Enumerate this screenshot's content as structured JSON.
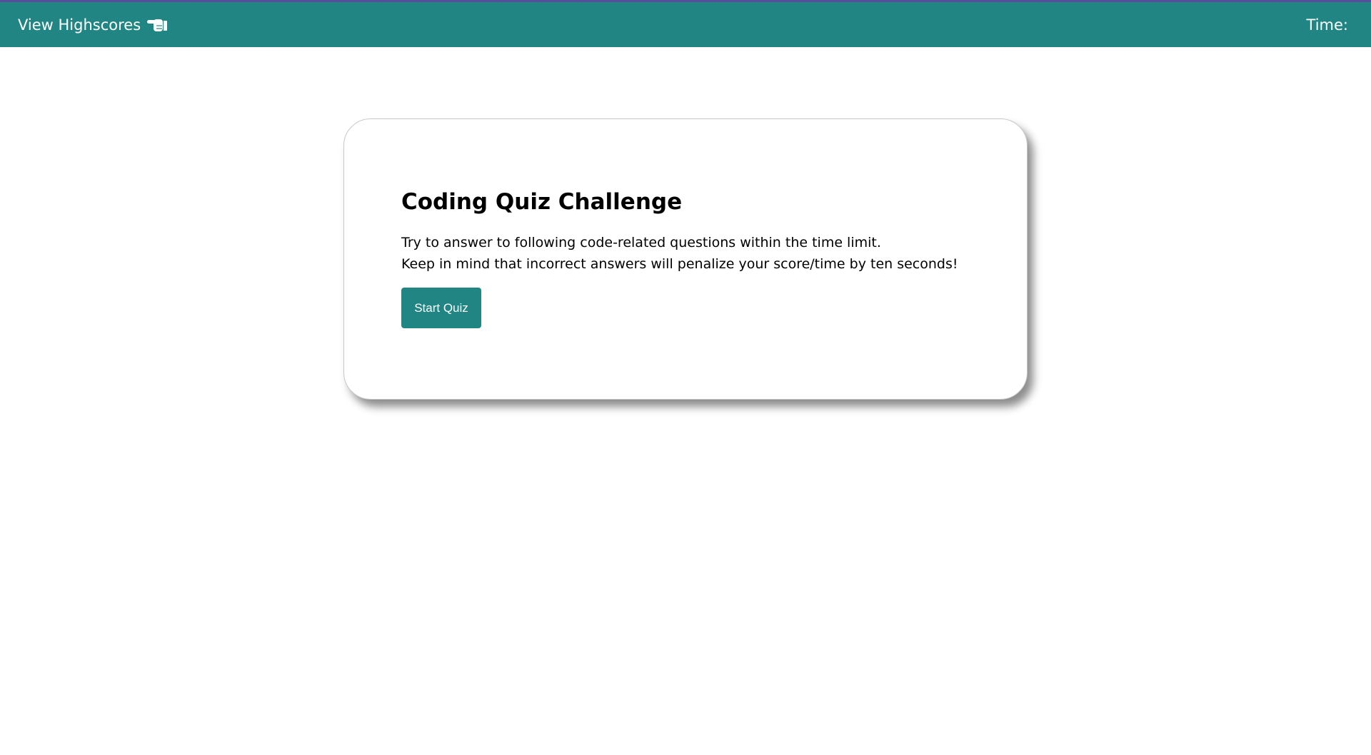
{
  "header": {
    "highscores_label": "View Highscores",
    "highscores_icon": "pointing-hand-icon",
    "timer_label": "Time:",
    "timer_value": ""
  },
  "card": {
    "title": "Coding Quiz Challenge",
    "line1": "Try to answer to following code-related questions within the time limit.",
    "line2": "Keep in mind that incorrect answers will penalize your score/time by ten seconds!",
    "start_button_label": "Start Quiz"
  },
  "colors": {
    "header_bg": "#218683",
    "top_accent": "#5a4d9c",
    "button_bg": "#218683",
    "page_bg": "#ffffff"
  }
}
